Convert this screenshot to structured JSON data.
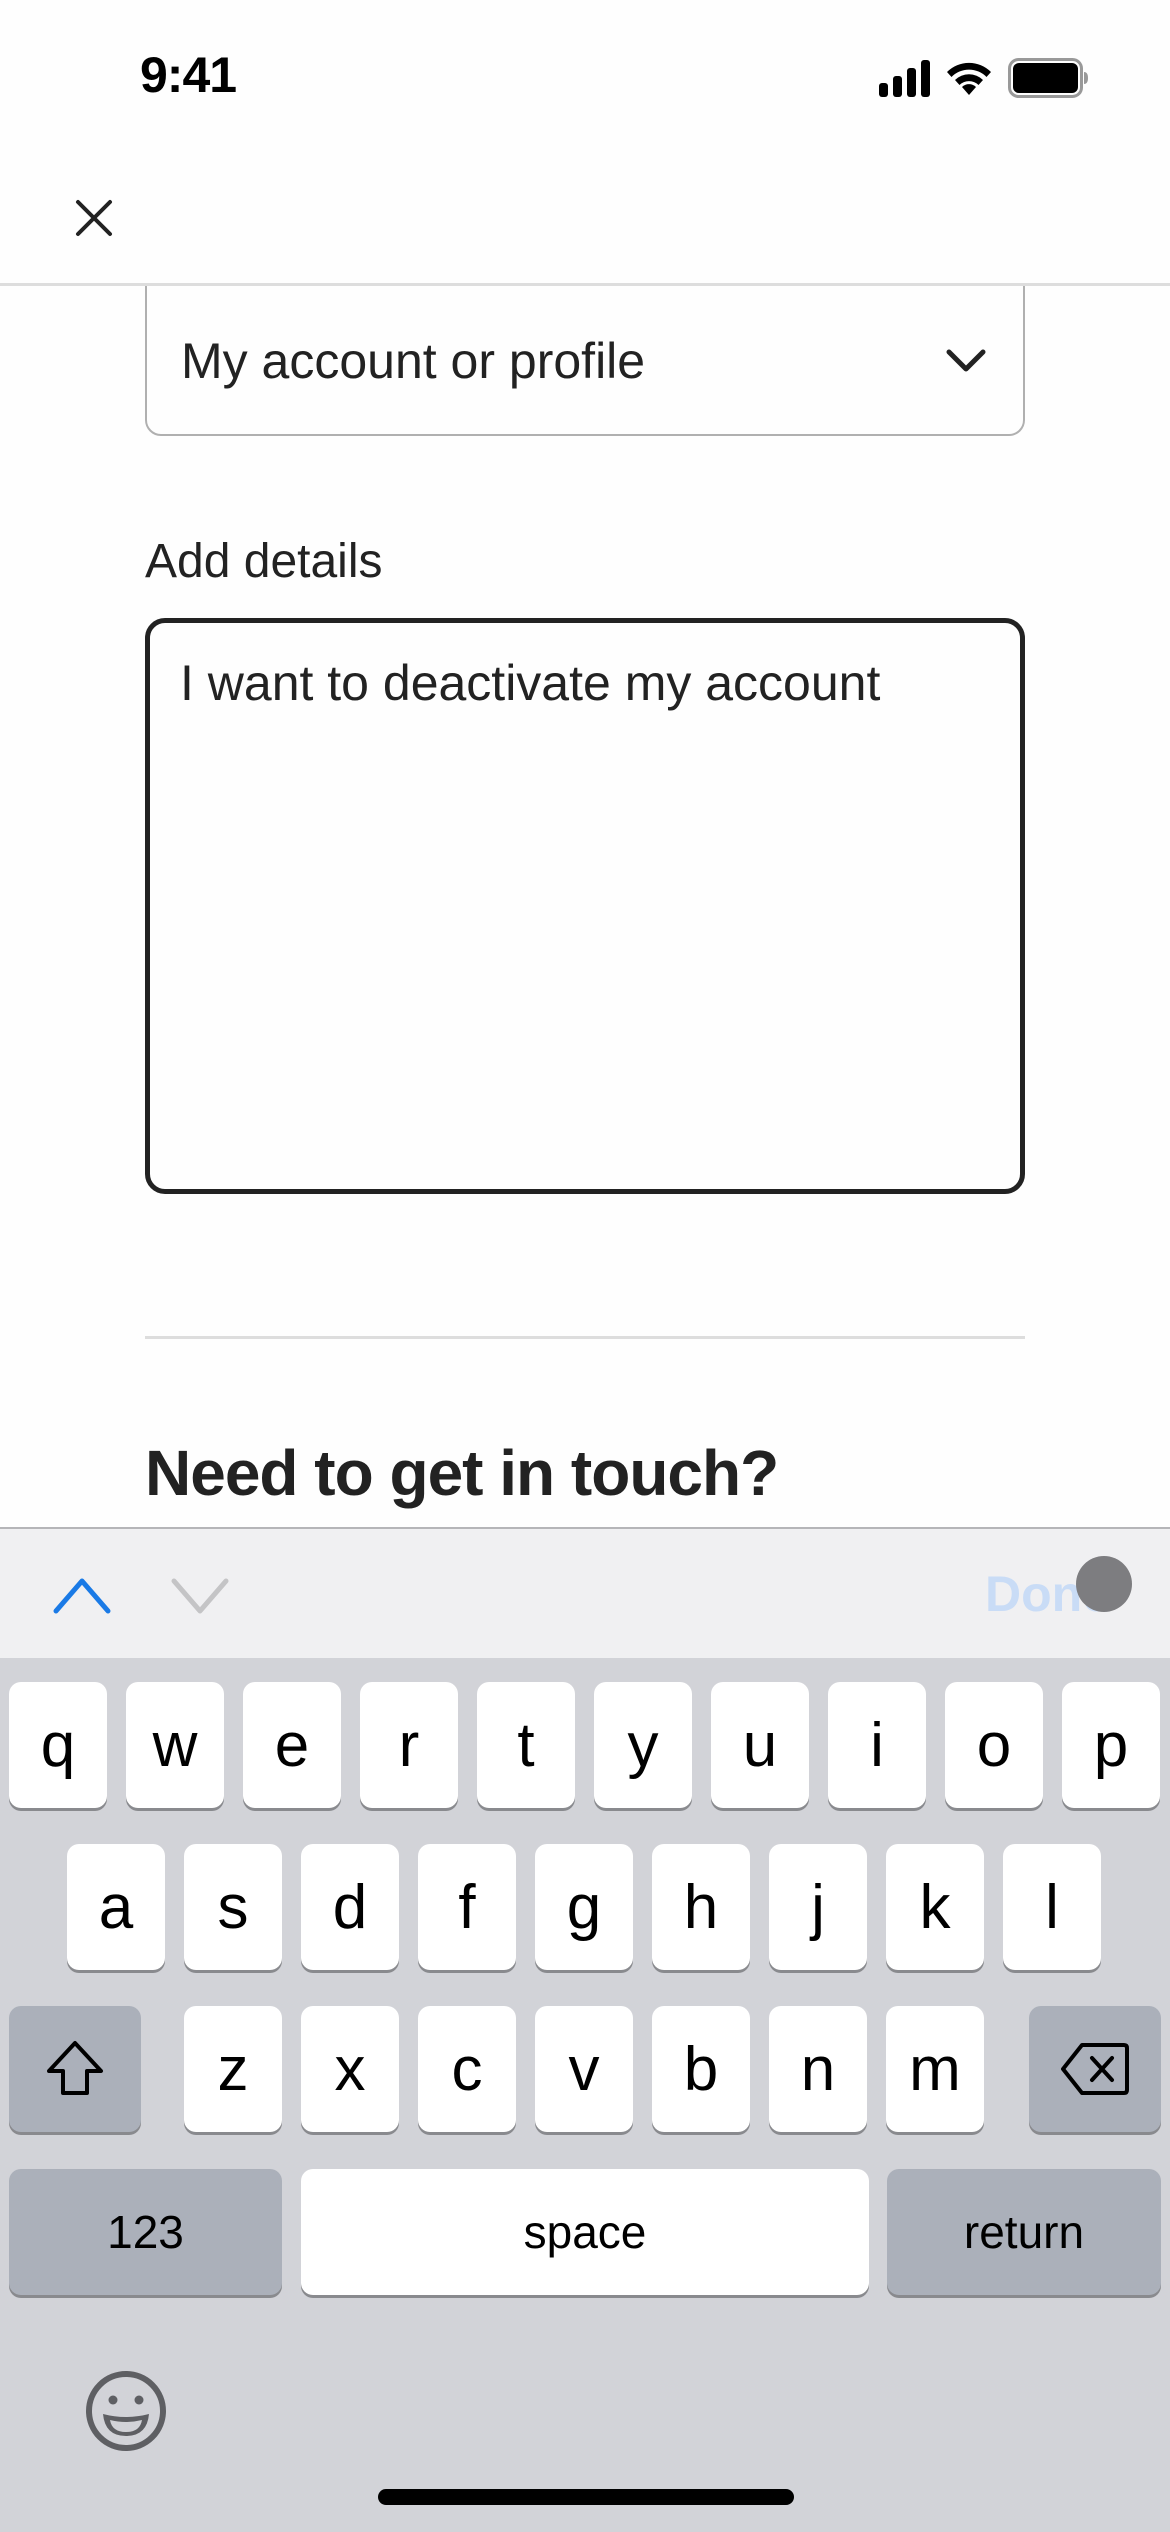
{
  "status_bar": {
    "time": "9:41",
    "icons": [
      "cellular-signal-icon",
      "wifi-icon",
      "battery-icon"
    ]
  },
  "nav": {
    "close_icon": "close-icon"
  },
  "form": {
    "topic_select": {
      "value": "My account or profile",
      "icon": "chevron-down-icon"
    },
    "details": {
      "label": "Add details",
      "value": "I want to deactivate my account"
    }
  },
  "section": {
    "heading": "Need to get in touch?"
  },
  "keyboard_accessory": {
    "prev_icon": "chevron-up-icon",
    "next_icon": "chevron-down-icon",
    "done_label": "Done",
    "colors": {
      "prev_active": "#1a7ae6",
      "next_disabled": "#c4c4c6",
      "done_disabled": "#c9dcf6"
    }
  },
  "keyboard": {
    "row1": [
      "q",
      "w",
      "e",
      "r",
      "t",
      "y",
      "u",
      "i",
      "o",
      "p"
    ],
    "row2": [
      "a",
      "s",
      "d",
      "f",
      "g",
      "h",
      "j",
      "k",
      "l"
    ],
    "row3": [
      "z",
      "x",
      "c",
      "v",
      "b",
      "n",
      "m"
    ],
    "shift_icon": "shift-icon",
    "delete_icon": "delete-backspace-icon",
    "numbers_label": "123",
    "space_label": "space",
    "return_label": "return",
    "emoji_icon": "emoji-icon"
  }
}
